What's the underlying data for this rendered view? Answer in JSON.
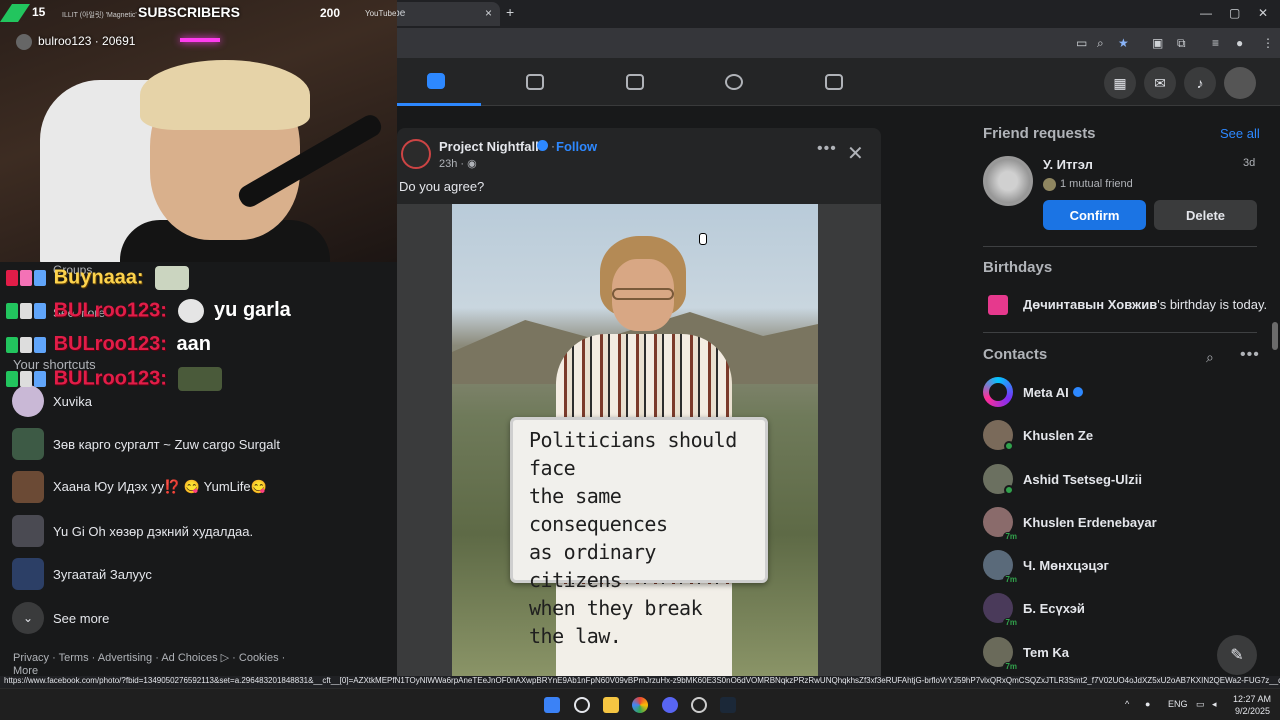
{
  "browser": {
    "tab_title": "YouTube",
    "new_tab": "+",
    "tab_close": "×",
    "window_controls": [
      "—",
      "▢",
      "✕"
    ]
  },
  "stream_overlay": {
    "sub_count": "15",
    "sub_small": "ILLIT (아일릿) 'Magnetic' ...",
    "sub_label": "SUBSCRIBERS",
    "sub_goal": "200",
    "sub_platform": "YouTube",
    "cam_user": "bulroo123 · 20691",
    "chat": [
      {
        "name": "Buynaaa:",
        "color": "yellow",
        "message": ""
      },
      {
        "name": "BULroo123:",
        "color": "red",
        "message": "yu garla"
      },
      {
        "name": "BULroo123:",
        "color": "red",
        "message": "aan"
      },
      {
        "name": "BULroo123:",
        "color": "red",
        "message": ""
      }
    ]
  },
  "left_sidebar": {
    "groups_label": "Groups",
    "see_more_top": "See more",
    "shortcuts_heading": "Your shortcuts",
    "shortcuts": [
      {
        "label": "Xuvika"
      },
      {
        "label": "Зөв карго сургалт ~ Zuw cargo Surgalt"
      },
      {
        "label": "Хаана Юу Идэх уу⁉️ 😋 YumLife😋"
      },
      {
        "label": "Yu Gi Oh хөзөр дэкний худалдаа."
      },
      {
        "label": "Зугаатай Залуус"
      }
    ],
    "see_more": "See more",
    "footer": "Privacy · Terms · Advertising · Ad Choices ▷ · Cookies ·",
    "footer_more": "More"
  },
  "post": {
    "author": "Project Nightfall",
    "follow_dot": "·",
    "follow": "Follow",
    "time": "23h · ◉",
    "text": "Do you agree?",
    "sign_lines": [
      "Politicians should face",
      "the same consequences",
      "as ordinary citizens",
      "when they break",
      "the law."
    ]
  },
  "right_sidebar": {
    "friend_requests": {
      "heading": "Friend requests",
      "see_all": "See all",
      "name": "У. Итгэл",
      "age": "3d",
      "mutual": "1 mutual friend",
      "confirm": "Confirm",
      "delete": "Delete"
    },
    "birthdays": {
      "heading": "Birthdays",
      "name": "Дөчинтавын Ховжив",
      "suffix": "'s birthday is today."
    },
    "contacts": {
      "heading": "Contacts",
      "items": [
        {
          "name": "Meta AI",
          "status": "verified"
        },
        {
          "name": "Khuslen Ze",
          "status": "online"
        },
        {
          "name": "Ashid Tsetseg-Ulzii",
          "status": "online"
        },
        {
          "name": "Khuslen Erdenebayar",
          "status": "7m"
        },
        {
          "name": "Ч. Мөнхцэцэг",
          "status": "7m"
        },
        {
          "name": "Б. Есүхэй",
          "status": "7m"
        },
        {
          "name": "Tem Ka",
          "status": "7m"
        }
      ]
    }
  },
  "status_url": "https://www.facebook.com/photo/?fbid=1349050276592113&set=a.296483201848831&__cft__[0]=AZXtkMEPfN1TOyNlWWa6rpAneTEeJnOF0nAXwpBRYnE9Ab1nFpN60V09vBPmJrzuHx-z9bMK60E3S0nO6dVOMRBNqkzPRzRwUNQhqkhsZf3xf3eRUFAhtjG-brfloVrYJ59hP7vlxQRxQmCSQZxJTLR3Smt2_f7V02UO4oJdXZ5xU2oAB7KXIN2QEWa2-FUG7z__qOsic4...",
  "taskbar": {
    "lang": "ENG",
    "time": "12:27 AM",
    "date": "9/2/2025"
  }
}
